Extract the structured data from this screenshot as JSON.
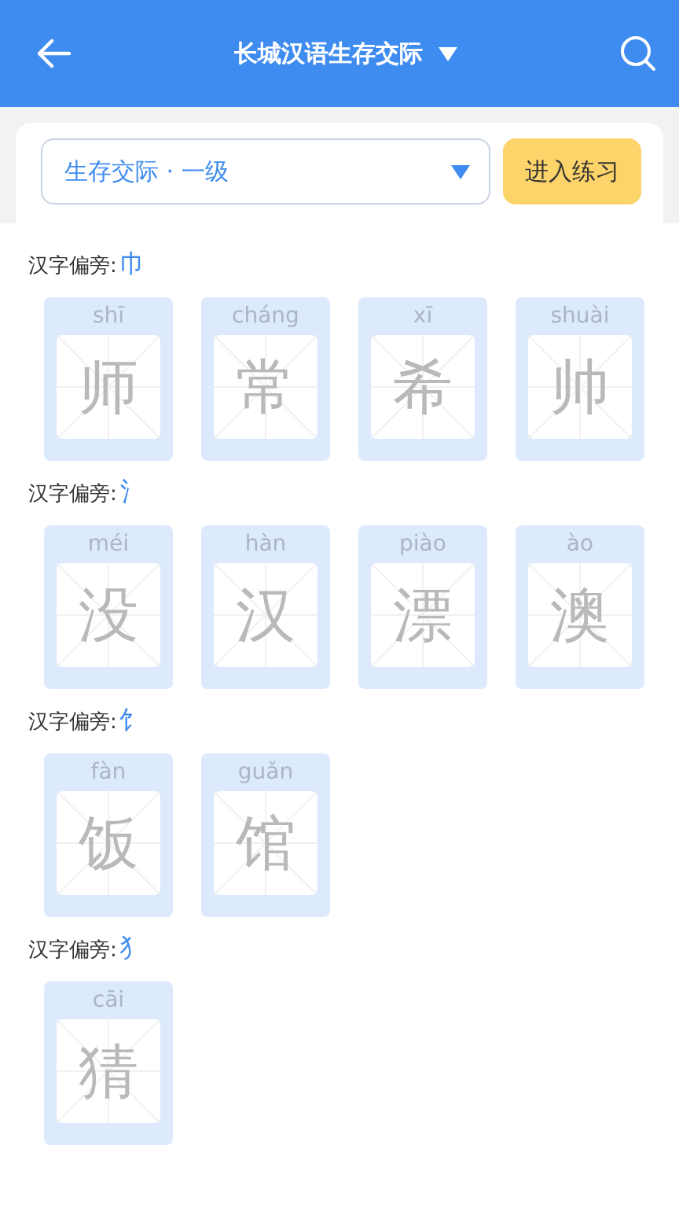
{
  "header": {
    "title": "长城汉语生存交际"
  },
  "selector": {
    "value": "生存交际 · 一级",
    "button": "进入练习"
  },
  "groups": [
    {
      "label": "汉字偏旁:",
      "radical": "巾",
      "characters": [
        {
          "pinyin": "shī",
          "hanzi": "师"
        },
        {
          "pinyin": "cháng",
          "hanzi": "常"
        },
        {
          "pinyin": "xī",
          "hanzi": "希"
        },
        {
          "pinyin": "shuài",
          "hanzi": "帅"
        }
      ]
    },
    {
      "label": "汉字偏旁:",
      "radical": "氵",
      "characters": [
        {
          "pinyin": "méi",
          "hanzi": "没"
        },
        {
          "pinyin": "hàn",
          "hanzi": "汉"
        },
        {
          "pinyin": "piào",
          "hanzi": "漂"
        },
        {
          "pinyin": "ào",
          "hanzi": "澳"
        }
      ]
    },
    {
      "label": "汉字偏旁:",
      "radical": "饣",
      "characters": [
        {
          "pinyin": "fàn",
          "hanzi": "饭"
        },
        {
          "pinyin": "guǎn",
          "hanzi": "馆"
        }
      ]
    },
    {
      "label": "汉字偏旁:",
      "radical": "犭",
      "characters": [
        {
          "pinyin": "cāi",
          "hanzi": "猜"
        }
      ]
    }
  ]
}
